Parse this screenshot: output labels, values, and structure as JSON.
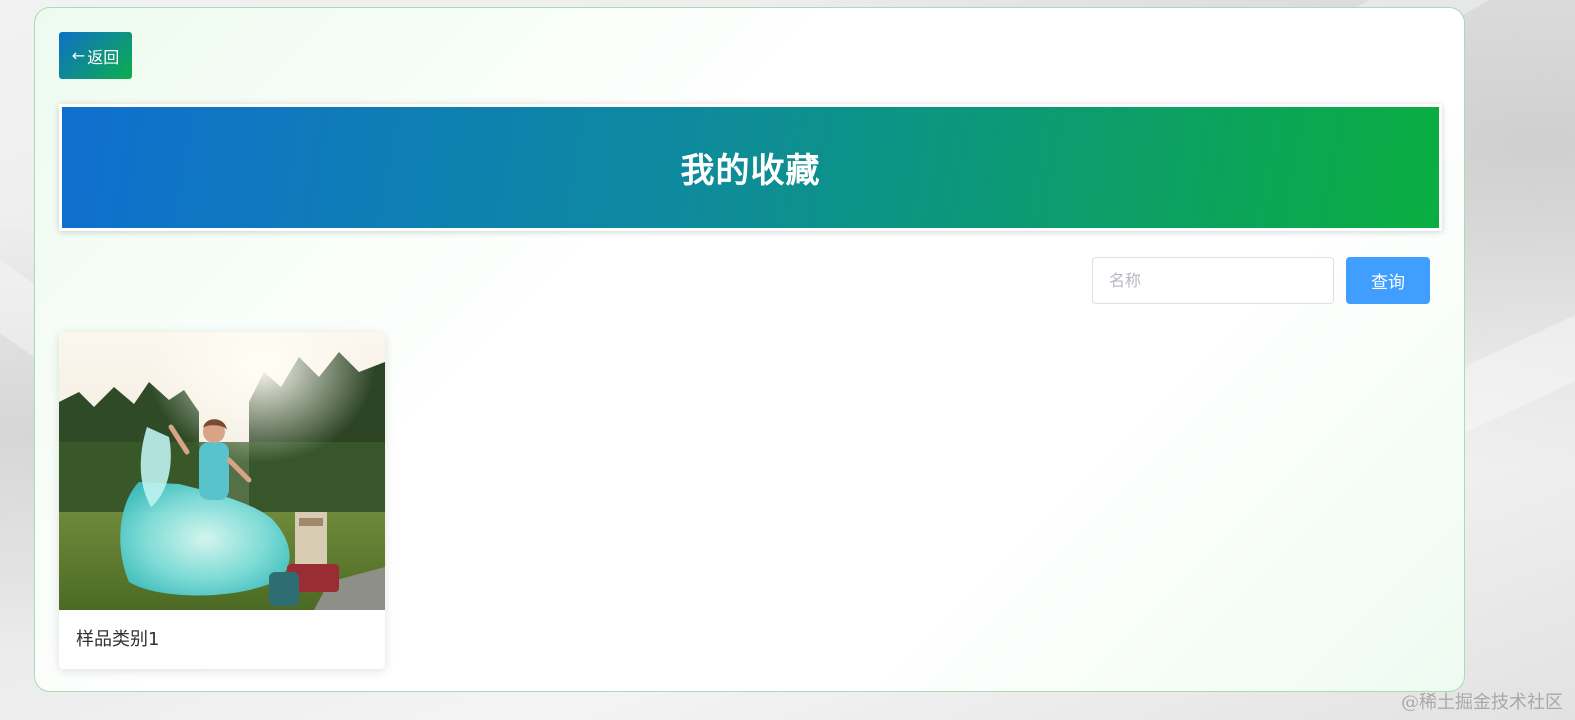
{
  "nav": {
    "back_arrow": "←",
    "back_label": "返回"
  },
  "banner": {
    "title": "我的收藏"
  },
  "search": {
    "placeholder": "名称",
    "value": "",
    "button_label": "查询"
  },
  "favorites": [
    {
      "title": "样品类别1",
      "image": "wedding-dress-photo"
    }
  ],
  "watermark": "@稀土掘金技术社区",
  "colors": {
    "primary_blue": "#409eff",
    "gradient_start": "#0f6fd0",
    "gradient_end": "#0aae40",
    "panel_border": "#a8dcb4"
  }
}
